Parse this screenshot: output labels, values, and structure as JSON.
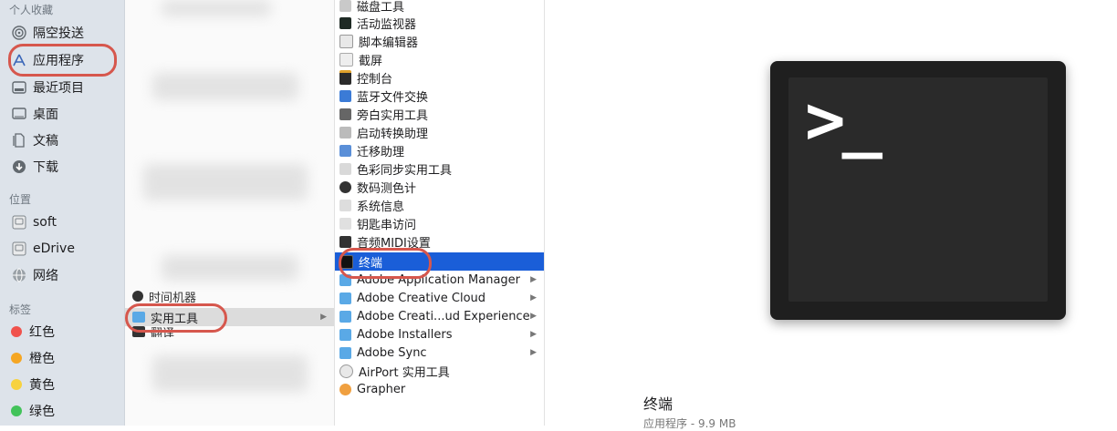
{
  "sidebar": {
    "favorites_title": "个人收藏",
    "favorites": [
      {
        "label": "隔空投送",
        "icon": "airdrop-icon"
      },
      {
        "label": "应用程序",
        "icon": "applications-icon"
      },
      {
        "label": "最近项目",
        "icon": "recents-icon"
      },
      {
        "label": "桌面",
        "icon": "desktop-icon"
      },
      {
        "label": "文稿",
        "icon": "documents-icon"
      },
      {
        "label": "下载",
        "icon": "downloads-icon"
      }
    ],
    "locations_title": "位置",
    "locations": [
      {
        "label": "soft",
        "icon": "disk-icon"
      },
      {
        "label": "eDrive",
        "icon": "disk-icon"
      },
      {
        "label": "网络",
        "icon": "network-icon"
      }
    ],
    "tags_title": "标签",
    "tags": [
      {
        "label": "红色",
        "color": "#f0524c"
      },
      {
        "label": "橙色",
        "color": "#f5a623"
      },
      {
        "label": "黄色",
        "color": "#f7d23e"
      },
      {
        "label": "绿色",
        "color": "#42c35a"
      }
    ]
  },
  "applications_column": {
    "items": [
      {
        "label": "时间机器"
      },
      {
        "label": "实用工具",
        "selected": true
      },
      {
        "label": "翻译"
      }
    ]
  },
  "utilities_column": {
    "items": [
      {
        "label": "磁盘工具"
      },
      {
        "label": "活动监视器"
      },
      {
        "label": "脚本编辑器"
      },
      {
        "label": "截屏"
      },
      {
        "label": "控制台"
      },
      {
        "label": "蓝牙文件交换"
      },
      {
        "label": "旁白实用工具"
      },
      {
        "label": "启动转换助理"
      },
      {
        "label": "迁移助理"
      },
      {
        "label": "色彩同步实用工具"
      },
      {
        "label": "数码测色计"
      },
      {
        "label": "系统信息"
      },
      {
        "label": "钥匙串访问"
      },
      {
        "label": "音频MIDI设置"
      },
      {
        "label": "终端",
        "selected": true
      },
      {
        "label": "Adobe Application Manager",
        "folder": true
      },
      {
        "label": "Adobe Creative Cloud",
        "folder": true
      },
      {
        "label": "Adobe Creati...ud Experience",
        "folder": true
      },
      {
        "label": "Adobe Installers",
        "folder": true
      },
      {
        "label": "Adobe Sync",
        "folder": true
      },
      {
        "label": "AirPort 实用工具"
      },
      {
        "label": "Grapher"
      }
    ]
  },
  "preview": {
    "icon": "terminal-app-icon",
    "prompt": ">_",
    "name": "终端",
    "subtitle": "应用程序 - 9.9 MB"
  },
  "colors": {
    "selection": "#1a5ed8",
    "highlight_oval": "#d6574d",
    "folder": "#5aa9e6"
  }
}
